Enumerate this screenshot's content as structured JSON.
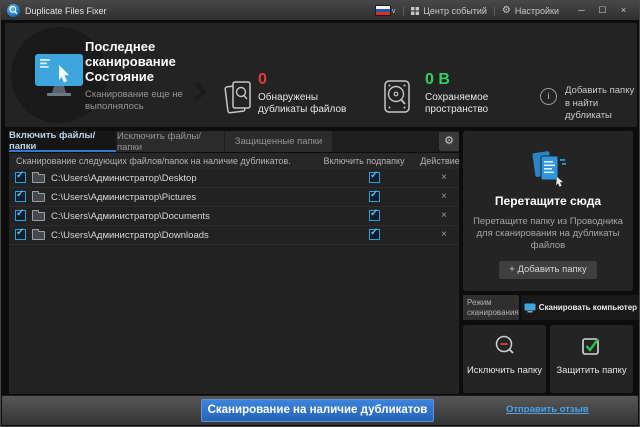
{
  "titlebar": {
    "title": "Duplicate Files Fixer",
    "events_center_label": "Центр событий",
    "settings_label": "Настройки"
  },
  "icons": {
    "language_flag": "russian-flag",
    "gear": "⚙",
    "minimize": "─",
    "maximize": "☐",
    "close": "×",
    "chevron_down": "∨",
    "check": "✓",
    "cross": "×",
    "info": "i"
  },
  "status_panel": {
    "last_scan_title": "Последнее сканирование Состояние",
    "last_scan_subtitle": "Сканирование еще не выполнялось",
    "duplicates": {
      "value": "0",
      "label": "Обнаружены дубликаты файлов",
      "color": "#e23b3b"
    },
    "space": {
      "value": "0 В",
      "label": "Сохраняемое пространство",
      "color": "#2fd05f"
    },
    "add_folder_hint": "Добавить папку в найти дубликаты"
  },
  "tabs": [
    {
      "label": "Включить файлы/папки",
      "active": true
    },
    {
      "label": "Исключить файлы/папки",
      "active": false
    },
    {
      "label": "Защищенные папки",
      "active": false
    }
  ],
  "table": {
    "header_path": "Сканирование следующих файлов/папок на наличие дубликатов.",
    "header_subfolder": "Включить подпапку",
    "header_action": "Действие",
    "rows": [
      {
        "path": "C:\\Users\\Администратор\\Desktop",
        "checked": true,
        "subfolder": true
      },
      {
        "path": "C:\\Users\\Администратор\\Pictures",
        "checked": true,
        "subfolder": true
      },
      {
        "path": "C:\\Users\\Администратор\\Documents",
        "checked": true,
        "subfolder": true
      },
      {
        "path": "C:\\Users\\Администратор\\Downloads",
        "checked": true,
        "subfolder": true
      }
    ]
  },
  "drop_panel": {
    "title": "Перетащите сюда",
    "description": "Перетащите папку из Проводника для сканирования на дубликаты файлов",
    "button": "+ Добавить папку"
  },
  "scan_mode": {
    "label": "Режим сканирования",
    "selected": "Сканировать компьютер"
  },
  "folder_actions": {
    "exclude": "Исключить папку",
    "protect": "Защитить папку"
  },
  "bottom_bar": {
    "scan_button": "Сканирование на наличие дубликатов",
    "feedback_link": "Отправить отзыв"
  },
  "colors": {
    "accent_blue": "#2e7cd2",
    "scan_button_blue": "#2d6fc6",
    "duplicates_red": "#e23b3b",
    "space_green": "#2fd05f",
    "link_blue": "#4da3e8"
  }
}
